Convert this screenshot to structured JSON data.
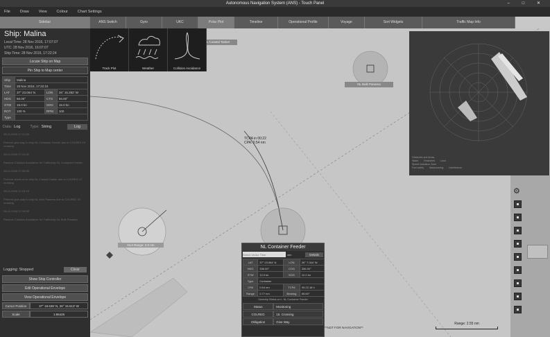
{
  "window": {
    "title": "Autonomous Navigation System (ANS) - Touch Panel",
    "controls": [
      "–",
      "□",
      "✕"
    ]
  },
  "menu": [
    "File",
    "Draw",
    "View",
    "Colour",
    "Chart Settings"
  ],
  "tabs": [
    "Sidebar",
    "ANS Switch",
    "Gyro",
    "UKC",
    "Polar Plot",
    "Timeline",
    "Operational Profile",
    "Voyage",
    "Sort Widgets",
    "Traffic Map Info"
  ],
  "sidebar": {
    "ship_name": "Ship: Malina",
    "local_time": "Local Time: 28 Nov 2016, 17:07:07",
    "utc": "UTC: 28 Nov 2016, 16:07:07",
    "ship_time": "Ship Time: 28 Nov 2016, 17:22:24",
    "locate_btn": "Locate Ship on Map",
    "pin_btn": "Pin Ship to Map center",
    "rows": [
      [
        "Ship",
        "Malina",
        "",
        ""
      ],
      [
        "Time",
        "28 Nov 2016, 17:22:24",
        "",
        ""
      ],
      [
        "LAT",
        "37° 23.064' N",
        "LON",
        "26° 15.282' W"
      ],
      [
        "HDG",
        "56.00°",
        "CTG",
        "56.00°"
      ],
      [
        "STW",
        "15.0 kn",
        "SOG",
        "15.0 kn"
      ],
      [
        "ROT",
        "100 %",
        "RPM",
        "100"
      ],
      [
        "Type",
        "",
        "",
        ""
      ]
    ],
    "log": {
      "data_label": "Data:",
      "data_value": "Log",
      "type_label": "Type:",
      "type_value": "String",
      "log_btn": "Log"
    },
    "log_entries": [
      "28-11-2016 17:21:55",
      "Perform give-way to ship NL Container Feeder due to COLREG 15 crossing",
      "28-11-2016 17:21:30",
      "Resume Collision Avoidance for Trafficship NL Container Feeder",
      "28-11-2016 17:20:55",
      "Perform stand-on to ship NL Coastal Tanker due to COLREG 17 crossing",
      "28-11-2016 17:20:15",
      "Perform give-way to ship NL Bulk Panama due to COLREG 15 crossing",
      "28-11-2016 17:19:55",
      "Resume Collision Avoidance for Trafficship NL Bulk Panama"
    ],
    "logging_status": "Logging: Stopped",
    "clear_btn": "Clear",
    "show_controller": "Show Ship Controller",
    "edit_env": "Edit Operational Envelope",
    "view_env": "View Operational Envelope",
    "cursor_label": "Cursor Position",
    "cursor_value": "37° 18.636' N, 26° 15.513' W",
    "scale_label": "Scale",
    "scale_value": "1:86425"
  },
  "widgets": [
    {
      "name": "Track Plot",
      "icon": "track-plot-icon"
    },
    {
      "name": "Weather",
      "icon": "weather-icon"
    },
    {
      "name": "Collision Avoidance",
      "icon": "collision-avoidance-icon"
    }
  ],
  "map": {
    "coastal_tanker": "NL Coastal Tanker",
    "bulk_panama": "NL Bulk Panama",
    "ownship_label": "NL3 Range: 2.0 nm",
    "tcpa": "TCPA in 00:22",
    "cpa": "CPA: 0.54 nm",
    "range_label": "Range: 2.55 nm",
    "nav_note": "**NOT FOR NAVIGATION**"
  },
  "polar_legend": [
    "Obstacles and Areas",
    "Water",
    "Restricted",
    "Land",
    "Speed Indication Zone",
    "Fuel safety",
    "Maneuvering",
    "Interference"
  ],
  "contact": {
    "title": "NL Container Feeder",
    "select_placeholder": "Select Vector Time",
    "min_label": "min",
    "details_btn": "Details",
    "rows": [
      [
        "LAT",
        "37° 23.064' N",
        "LON",
        "26° 7.044' W"
      ],
      [
        "HDG",
        "336.00°",
        "COG",
        "336.00°"
      ],
      [
        "STW",
        "12.0 kn",
        "SOG",
        "12.0 kn"
      ],
      [
        "Type",
        "Container",
        "",
        ""
      ],
      [
        "CPA",
        "0.54 nm",
        "TCPA",
        "00:22:18 h"
      ],
      [
        "Range",
        "0.77 nm",
        "Bearing",
        "65.60°"
      ]
    ],
    "note": "Ownship Status w.r.t. NL Container Feeder",
    "status": [
      [
        "Status",
        "Monitoring"
      ],
      [
        "COLREG",
        "15. Crossing"
      ],
      [
        "Obligation",
        "Give Way"
      ]
    ]
  },
  "colors": {
    "accent": "#7c7c7c",
    "panel": "#2f2f2f",
    "map": "#c6c6c6"
  }
}
